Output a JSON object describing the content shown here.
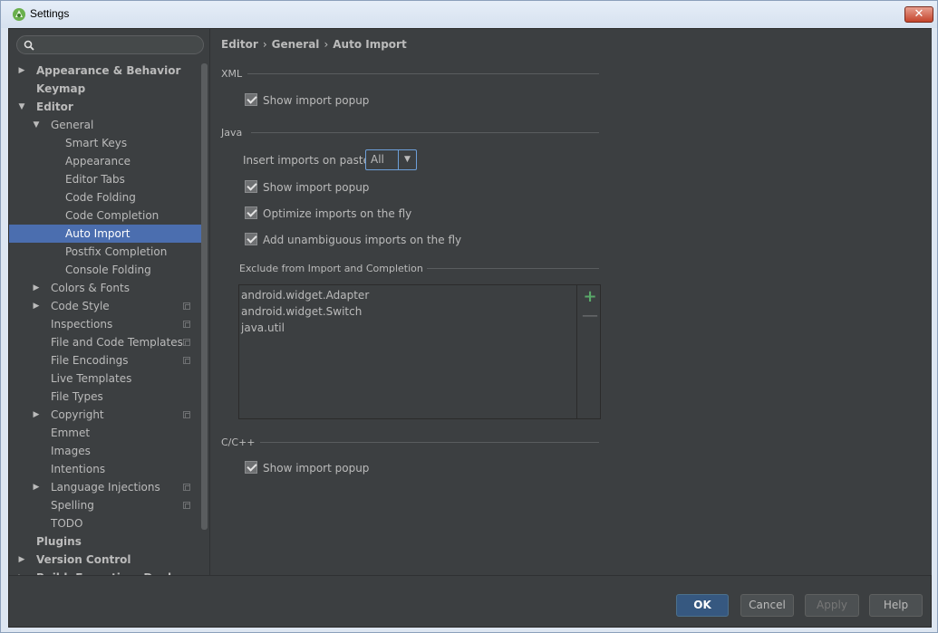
{
  "window": {
    "title": "Settings",
    "close_label": "✕"
  },
  "search": {
    "placeholder": ""
  },
  "tree": [
    {
      "label": "Appearance & Behavior",
      "level": 0,
      "arrow": "▶",
      "bold": true
    },
    {
      "label": "Keymap",
      "level": 0,
      "arrow": "",
      "bold": true
    },
    {
      "label": "Editor",
      "level": 0,
      "arrow": "▼",
      "bold": true
    },
    {
      "label": "General",
      "level": 1,
      "arrow": "▼"
    },
    {
      "label": "Smart Keys",
      "level": 2,
      "arrow": ""
    },
    {
      "label": "Appearance",
      "level": 2,
      "arrow": ""
    },
    {
      "label": "Editor Tabs",
      "level": 2,
      "arrow": ""
    },
    {
      "label": "Code Folding",
      "level": 2,
      "arrow": ""
    },
    {
      "label": "Code Completion",
      "level": 2,
      "arrow": ""
    },
    {
      "label": "Auto Import",
      "level": 2,
      "arrow": "",
      "selected": true
    },
    {
      "label": "Postfix Completion",
      "level": 2,
      "arrow": ""
    },
    {
      "label": "Console Folding",
      "level": 2,
      "arrow": ""
    },
    {
      "label": "Colors & Fonts",
      "level": 1,
      "arrow": "▶"
    },
    {
      "label": "Code Style",
      "level": 1,
      "arrow": "▶",
      "copy": true
    },
    {
      "label": "Inspections",
      "level": 1,
      "arrow": "",
      "copy": true
    },
    {
      "label": "File and Code Templates",
      "level": 1,
      "arrow": "",
      "copy": true
    },
    {
      "label": "File Encodings",
      "level": 1,
      "arrow": "",
      "copy": true
    },
    {
      "label": "Live Templates",
      "level": 1,
      "arrow": ""
    },
    {
      "label": "File Types",
      "level": 1,
      "arrow": ""
    },
    {
      "label": "Copyright",
      "level": 1,
      "arrow": "▶",
      "copy": true
    },
    {
      "label": "Emmet",
      "level": 1,
      "arrow": ""
    },
    {
      "label": "Images",
      "level": 1,
      "arrow": ""
    },
    {
      "label": "Intentions",
      "level": 1,
      "arrow": ""
    },
    {
      "label": "Language Injections",
      "level": 1,
      "arrow": "▶",
      "copy": true
    },
    {
      "label": "Spelling",
      "level": 1,
      "arrow": "",
      "copy": true
    },
    {
      "label": "TODO",
      "level": 1,
      "arrow": ""
    },
    {
      "label": "Plugins",
      "level": 0,
      "arrow": "",
      "bold": true
    },
    {
      "label": "Version Control",
      "level": 0,
      "arrow": "▶",
      "bold": true
    },
    {
      "label": "Build, Execution, Deployment",
      "level": 0,
      "arrow": "▶",
      "bold": true
    }
  ],
  "breadcrumb": {
    "part1": "Editor",
    "part2": "General",
    "part3": "Auto Import",
    "separator": "›"
  },
  "xml": {
    "label": "XML",
    "show_import_popup": {
      "label": "Show import popup",
      "checked": true
    }
  },
  "java": {
    "label": "Java",
    "insert_imports_label": "Insert imports on paste:",
    "insert_imports_value": "All",
    "show_import_popup": {
      "label": "Show import popup",
      "checked": true
    },
    "optimize_imports": {
      "label": "Optimize imports on the fly",
      "checked": true
    },
    "add_unambiguous": {
      "label": "Add unambiguous imports on the fly",
      "checked": true
    },
    "exclude_label": "Exclude from Import and Completion",
    "exclude_items": [
      "android.widget.Adapter",
      "android.widget.Switch",
      "java.util"
    ],
    "add_label": "+",
    "remove_label": "—"
  },
  "cpp": {
    "label": "C/C++",
    "show_import_popup": {
      "label": "Show import popup",
      "checked": true
    }
  },
  "footer": {
    "ok": "OK",
    "cancel": "Cancel",
    "apply": "Apply",
    "help": "Help"
  },
  "colors": {
    "selection": "#4b6eaf",
    "background": "#3c3f41",
    "add_green": "#59a869",
    "primary_button": "#365880"
  }
}
